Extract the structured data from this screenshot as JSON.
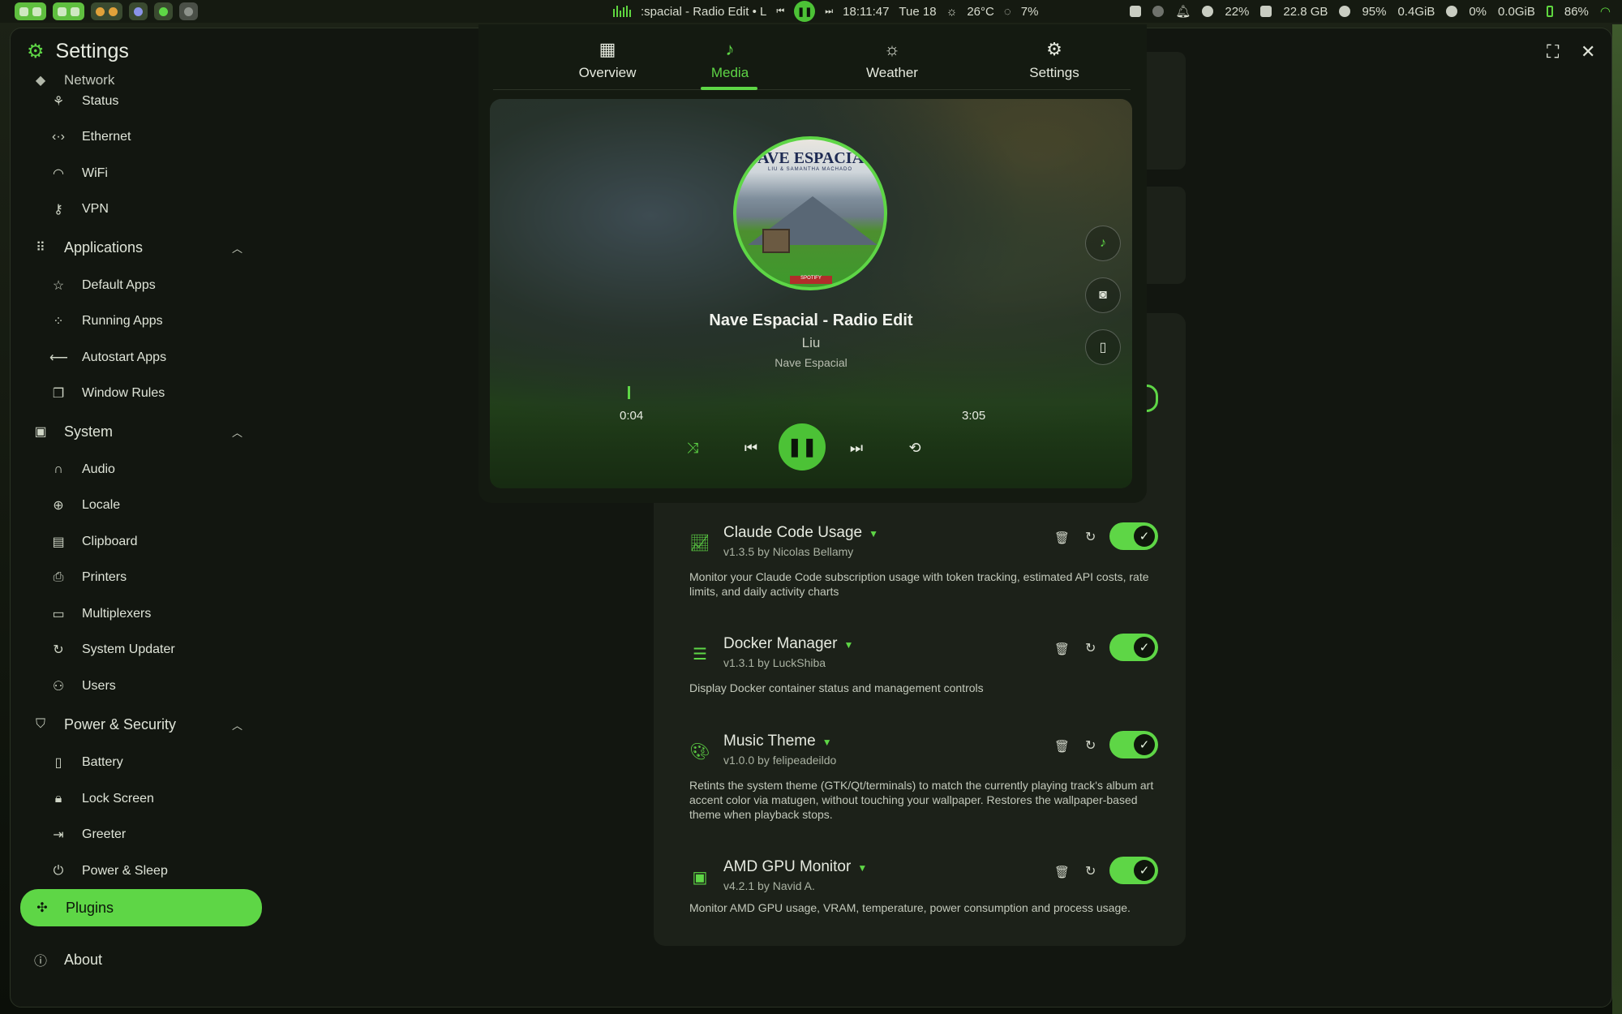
{
  "topbar": {
    "media_text": ":spacial - Radio Edit • L",
    "clock": "18:11:47",
    "date": "Tue 18",
    "temp": "26°C",
    "cpu": "7%",
    "notif_pct": "22%",
    "disk": "22.8 GB",
    "mem_pct": "95%",
    "mem": "0.4GiB",
    "gpu_pct": "0%",
    "vram": "0.0GiB",
    "battery": "86%"
  },
  "window": {
    "title": "Settings",
    "fullscreen_icon": "fullscreen-icon",
    "close_icon": "close-icon"
  },
  "sidebar": {
    "partial_item": "Network",
    "items": [
      {
        "label": "Status"
      },
      {
        "label": "Ethernet"
      },
      {
        "label": "WiFi"
      },
      {
        "label": "VPN"
      },
      {
        "label": "Applications"
      },
      {
        "label": "Default Apps"
      },
      {
        "label": "Running Apps"
      },
      {
        "label": "Autostart Apps"
      },
      {
        "label": "Window Rules"
      },
      {
        "label": "System"
      },
      {
        "label": "Audio"
      },
      {
        "label": "Locale"
      },
      {
        "label": "Clipboard"
      },
      {
        "label": "Printers"
      },
      {
        "label": "Multiplexers"
      },
      {
        "label": "System Updater"
      },
      {
        "label": "Users"
      },
      {
        "label": "Power & Security"
      },
      {
        "label": "Battery"
      },
      {
        "label": "Lock Screen"
      },
      {
        "label": "Greeter"
      },
      {
        "label": "Power & Sleep"
      },
      {
        "label": "Plugins"
      },
      {
        "label": "About"
      }
    ]
  },
  "popup": {
    "tabs": [
      {
        "label": "Overview"
      },
      {
        "label": "Media"
      },
      {
        "label": "Weather"
      },
      {
        "label": "Settings"
      }
    ],
    "active_tab": "Media",
    "track": {
      "title": "Nave Espacial - Radio Edit",
      "artist": "Liu",
      "album": "Nave Espacial",
      "time_current": "0:04",
      "time_total": "3:05",
      "cover_title": "NAVE ESPACIAL",
      "cover_sub": "LIU & SAMANTHA MACHADO",
      "cover_badge": "SPOTIFY"
    }
  },
  "plugins": [
    {
      "name": "Claude Code Usage",
      "version": "v1.3.5 by Nicolas Bellamy",
      "desc": "Monitor your Claude Code subscription usage with token tracking, estimated API costs, rate limits, and daily activity charts",
      "enabled": true,
      "icon": "chart-icon"
    },
    {
      "name": "Docker Manager",
      "version": "v1.3.1 by LuckShiba",
      "desc": "Display Docker container status and management controls",
      "enabled": true,
      "icon": "server-icon"
    },
    {
      "name": "Music Theme",
      "version": "v1.0.0 by felipeadeildo",
      "desc": "Retints the system theme (GTK/Qt/terminals) to match the currently playing track's album art accent color via matugen, without touching your wallpaper. Restores the wallpaper-based theme when playback stops.",
      "enabled": true,
      "icon": "palette-icon"
    },
    {
      "name": "AMD GPU Monitor",
      "version": "v4.2.1 by Navid A.",
      "desc": "Monitor AMD GPU usage, VRAM, temperature, power consumption and process usage.",
      "enabled": true,
      "icon": "chip-icon"
    }
  ],
  "colors": {
    "accent": "#5ed646",
    "background": "#121610",
    "card": "#1c2119"
  }
}
